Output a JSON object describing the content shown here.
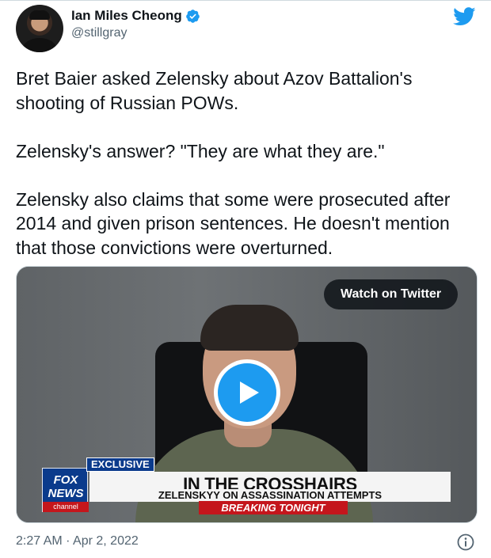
{
  "author": {
    "display_name": "Ian Miles Cheong",
    "handle": "@stillgray",
    "verified": true,
    "avatar_icon": "user-avatar"
  },
  "brand": {
    "logo_icon": "twitter-bird-icon",
    "color": "#1d9bf0"
  },
  "tweet": {
    "text": "Bret Baier asked Zelensky about Azov Battalion's shooting of Russian POWs.\n\nZelensky's answer? \"They are what they are.\"\n\nZelensky also claims that some were prosecuted after 2014 and given prison sentences. He doesn't mention that those convictions were overturned."
  },
  "media": {
    "watch_label": "Watch on Twitter",
    "play_icon": "play-icon",
    "chyron": {
      "logo_line1": "FOX",
      "logo_line2": "NEWS",
      "logo_line3": "channel",
      "tag": "EXCLUSIVE",
      "headline": "IN THE CROSSHAIRS",
      "subline": "ZELENSKYY ON ASSASSINATION ATTEMPTS",
      "breaking": "BREAKING TONIGHT"
    }
  },
  "footer": {
    "timestamp": "2:27 AM · Apr 2, 2022",
    "info_icon": "info-icon"
  }
}
